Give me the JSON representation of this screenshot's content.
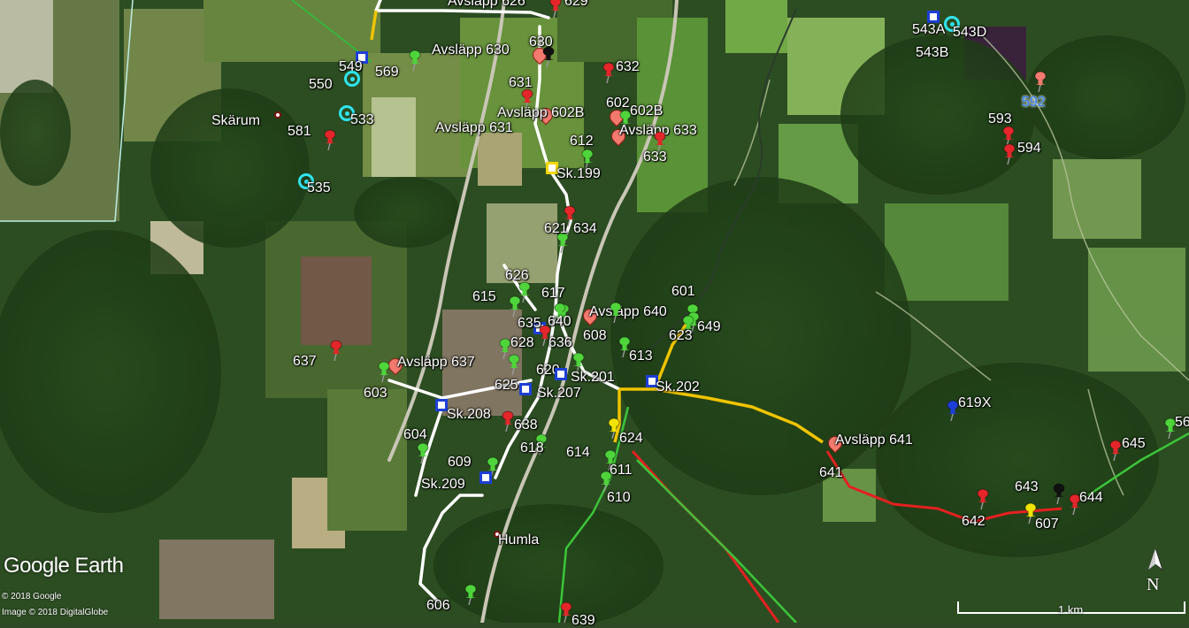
{
  "map": {
    "colors": {
      "pin_red": "#e3262a",
      "pin_green": "#4fd43b",
      "pin_yellow": "#f2e300",
      "pin_blue": "#1d3fd6",
      "pin_black": "#111111",
      "pin_pink": "#f47a6e",
      "ring_cyan": "#2ee6f0"
    },
    "place_labels": [
      {
        "id": "skarum",
        "text": "Skärum"
      },
      {
        "id": "humla",
        "text": "Humla"
      }
    ],
    "markers": [
      {
        "id": "m629",
        "label": "629",
        "icon": "pushpin-red"
      },
      {
        "id": "m630",
        "label": "630",
        "icon": "drop-pink"
      },
      {
        "id": "avs630",
        "label": "Avsläpp 630",
        "icon": "pushpin-black"
      },
      {
        "id": "avs626",
        "label": "Avsläpp 626",
        "icon": "none"
      },
      {
        "id": "m632",
        "label": "632",
        "icon": "pushpin-red"
      },
      {
        "id": "m631",
        "label": "631",
        "icon": "pushpin-red"
      },
      {
        "id": "avs602b",
        "label": "Avsläpp 602B",
        "icon": "drop-pink"
      },
      {
        "id": "avs631",
        "label": "Avsläpp 631",
        "icon": "none"
      },
      {
        "id": "m602",
        "label": "602",
        "icon": "drop-pink"
      },
      {
        "id": "m602b",
        "label": "602B",
        "icon": "pushpin-green"
      },
      {
        "id": "avs633",
        "label": "Avsläpp 633",
        "icon": "drop-pink"
      },
      {
        "id": "m633",
        "label": "633",
        "icon": "pushpin-red"
      },
      {
        "id": "m612",
        "label": "612",
        "icon": "pushpin-green"
      },
      {
        "id": "sk199",
        "label": "Sk.199",
        "icon": "square-yellow"
      },
      {
        "id": "m621",
        "label": "621",
        "icon": "pushpin-green"
      },
      {
        "id": "m634",
        "label": "634",
        "icon": "pushpin-red"
      },
      {
        "id": "m626",
        "label": "626",
        "icon": "pushpin-green"
      },
      {
        "id": "m615",
        "label": "615",
        "icon": "pushpin-green"
      },
      {
        "id": "m617",
        "label": "617",
        "icon": "pushpin-green"
      },
      {
        "id": "m635",
        "label": "635",
        "icon": "square-blue"
      },
      {
        "id": "m640",
        "label": "640",
        "icon": "pushpin-green"
      },
      {
        "id": "avs640",
        "label": "Avsläpp 640",
        "icon": "drop-pink"
      },
      {
        "id": "m601",
        "label": "601",
        "icon": "pushpin-green"
      },
      {
        "id": "m649",
        "label": "649",
        "icon": "pushpin-green"
      },
      {
        "id": "m623",
        "label": "623",
        "icon": "pushpin-green"
      },
      {
        "id": "m628",
        "label": "628",
        "icon": "pushpin-green"
      },
      {
        "id": "m636",
        "label": "636",
        "icon": "pushpin-red"
      },
      {
        "id": "m608",
        "label": "608",
        "icon": "pushpin-green"
      },
      {
        "id": "m613",
        "label": "613",
        "icon": "pushpin-green"
      },
      {
        "id": "m620",
        "label": "620",
        "icon": "pushpin-green"
      },
      {
        "id": "m625",
        "label": "625",
        "icon": "pushpin-green"
      },
      {
        "id": "sk207",
        "label": "Sk.207",
        "icon": "square-blue"
      },
      {
        "id": "sk201",
        "label": "Sk.201",
        "icon": "square-blue"
      },
      {
        "id": "sk202",
        "label": "Sk.202",
        "icon": "square-blue"
      },
      {
        "id": "m637",
        "label": "637",
        "icon": "pushpin-red"
      },
      {
        "id": "avs637",
        "label": "Avsläpp 637",
        "icon": "drop-pink"
      },
      {
        "id": "m603",
        "label": "603",
        "icon": "pushpin-green"
      },
      {
        "id": "sk208",
        "label": "Sk.208",
        "icon": "square-blue"
      },
      {
        "id": "m638",
        "label": "638",
        "icon": "pushpin-red"
      },
      {
        "id": "m604",
        "label": "604",
        "icon": "pushpin-green"
      },
      {
        "id": "m618",
        "label": "618",
        "icon": "pushpin-green"
      },
      {
        "id": "m609",
        "label": "609",
        "icon": "pushpin-green"
      },
      {
        "id": "sk209",
        "label": "Sk.209",
        "icon": "square-blue"
      },
      {
        "id": "m614",
        "label": "614",
        "icon": "none"
      },
      {
        "id": "m624",
        "label": "624",
        "icon": "pushpin-yellow"
      },
      {
        "id": "m611",
        "label": "611",
        "icon": "pushpin-green"
      },
      {
        "id": "m610",
        "label": "610",
        "icon": "pushpin-green"
      },
      {
        "id": "m606",
        "label": "606",
        "icon": "pushpin-green"
      },
      {
        "id": "m639",
        "label": "639",
        "icon": "pushpin-red"
      },
      {
        "id": "m619x",
        "label": "619X",
        "icon": "pushpin-blue"
      },
      {
        "id": "avs641",
        "label": "Avsläpp 641",
        "icon": "drop-pink"
      },
      {
        "id": "m641",
        "label": "641",
        "icon": "none"
      },
      {
        "id": "m645",
        "label": "645",
        "icon": "pushpin-red"
      },
      {
        "id": "m56x",
        "label": "56",
        "icon": "pushpin-green"
      },
      {
        "id": "m643",
        "label": "643",
        "icon": "pushpin-black"
      },
      {
        "id": "m644",
        "label": "644",
        "icon": "pushpin-red"
      },
      {
        "id": "m642",
        "label": "642",
        "icon": "pushpin-red"
      },
      {
        "id": "m607",
        "label": "607",
        "icon": "pushpin-yellow"
      },
      {
        "id": "m549",
        "label": "549",
        "icon": "square-blue"
      },
      {
        "id": "m569",
        "label": "569",
        "icon": "pushpin-green"
      },
      {
        "id": "m550",
        "label": "550",
        "icon": "ring-cyan"
      },
      {
        "id": "m533",
        "label": "533",
        "icon": "ring-cyan"
      },
      {
        "id": "m581",
        "label": "581",
        "icon": "pushpin-red"
      },
      {
        "id": "m535",
        "label": "535",
        "icon": "ring-cyan"
      },
      {
        "id": "m543a",
        "label": "543A",
        "icon": "square-blue"
      },
      {
        "id": "m543d",
        "label": "543D",
        "icon": "ring-cyan"
      },
      {
        "id": "m543b",
        "label": "543B",
        "icon": "none"
      },
      {
        "id": "m592",
        "label": "592",
        "icon": "pushpin-pink"
      },
      {
        "id": "m593",
        "label": "593",
        "icon": "pushpin-red"
      },
      {
        "id": "m594",
        "label": "594",
        "icon": "pushpin-red"
      }
    ],
    "logo": "Google Earth",
    "copyright_1": "© 2018 Google",
    "copyright_2": "Image © 2018 DigitalGlobe",
    "compass_label": "N",
    "scale_label": "1 km"
  }
}
